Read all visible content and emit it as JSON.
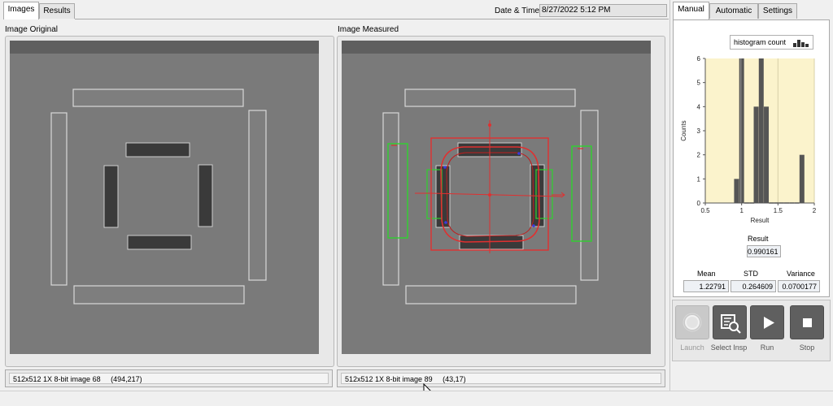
{
  "left_tabs": [
    {
      "label": "Images",
      "active": true
    },
    {
      "label": "Results",
      "active": false
    }
  ],
  "datetime": {
    "label": "Date & Time:",
    "value": "8/27/2022  5:12 PM"
  },
  "panels": {
    "original": {
      "title": "Image Original",
      "status": "512x512 1X 8-bit image 68",
      "coords": "(494,217)"
    },
    "measured": {
      "title": "Image Measured",
      "status": "512x512 1X 8-bit image 89",
      "coords": "(43,17)"
    }
  },
  "right_tabs": [
    {
      "label": "Manual",
      "active": true
    },
    {
      "label": "Automatic",
      "active": false
    },
    {
      "label": "Settings",
      "active": false
    }
  ],
  "histogram": {
    "legend": "histogram count",
    "chart_data": {
      "type": "bar",
      "xlabel": "Result",
      "ylabel": "Counts",
      "xlim": [
        0.5,
        2.0
      ],
      "ylim": [
        0,
        6
      ],
      "x_ticks": [
        "0.5",
        "1",
        "1.5",
        "2"
      ],
      "y_ticks": [
        "0",
        "1",
        "2",
        "3",
        "4",
        "5",
        "6"
      ],
      "bins": [
        {
          "x": 0.93,
          "count": 1
        },
        {
          "x": 1.0,
          "count": 6
        },
        {
          "x": 1.07,
          "count": 0
        },
        {
          "x": 1.14,
          "count": 0
        },
        {
          "x": 1.2,
          "count": 4
        },
        {
          "x": 1.27,
          "count": 6
        },
        {
          "x": 1.34,
          "count": 4
        },
        {
          "x": 1.41,
          "count": 0
        },
        {
          "x": 1.48,
          "count": 0
        },
        {
          "x": 1.55,
          "count": 0
        },
        {
          "x": 1.62,
          "count": 0
        },
        {
          "x": 1.69,
          "count": 0
        },
        {
          "x": 1.76,
          "count": 0
        },
        {
          "x": 1.83,
          "count": 2
        }
      ],
      "vline_x": 0.99
    }
  },
  "result": {
    "label": "Result",
    "value": "0.990161"
  },
  "stats": [
    {
      "label": "Mean",
      "value": "1.22791"
    },
    {
      "label": "STD",
      "value": "0.264609"
    },
    {
      "label": "Variance",
      "value": "0.0700177"
    }
  ],
  "controls": [
    {
      "label": "Launch",
      "icon": "launch-icon",
      "enabled": false
    },
    {
      "label": "Select Insp",
      "icon": "select-insp-icon",
      "enabled": true
    },
    {
      "label": "Run",
      "icon": "play-icon",
      "enabled": true
    },
    {
      "label": "Stop",
      "icon": "stop-icon",
      "enabled": true
    }
  ],
  "colors": {
    "chart_bg": "#fbf3cc",
    "bar": "#555555",
    "fit_red": "#e03030",
    "edge_green": "#2fd22f"
  }
}
